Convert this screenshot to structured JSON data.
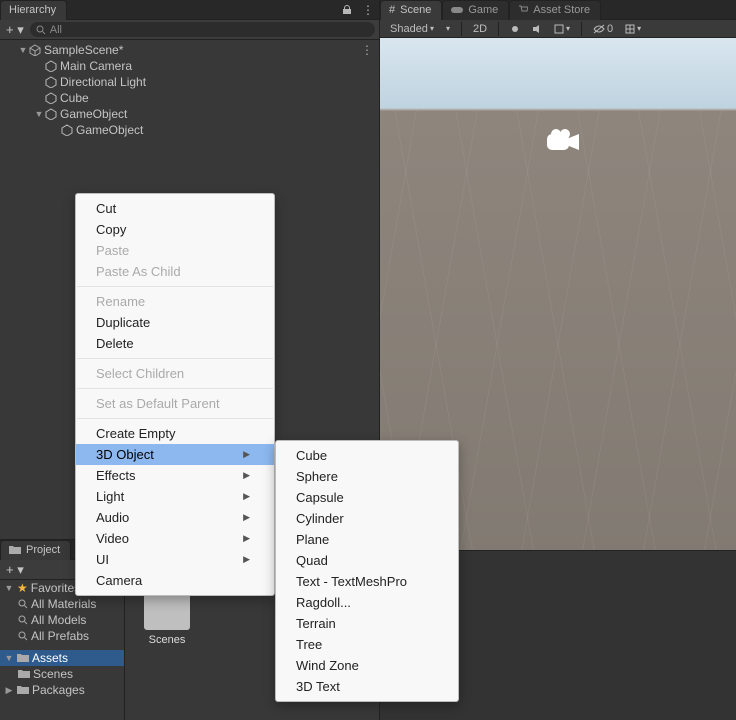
{
  "hierarchy": {
    "tab": "Hierarchy",
    "searchPlaceholder": "All",
    "scene": "SampleScene*",
    "items": [
      "Main Camera",
      "Directional Light",
      "Cube",
      "GameObject",
      "GameObject"
    ]
  },
  "project": {
    "tab": "Project",
    "favorites": {
      "label": "Favorites",
      "items": [
        "All Materials",
        "All Models",
        "All Prefabs"
      ]
    },
    "assets": {
      "label": "Assets",
      "items": [
        "Scenes"
      ]
    },
    "packages": "Packages",
    "content": {
      "folder": "Scenes"
    }
  },
  "scene": {
    "tabs": {
      "scene": "Scene",
      "game": "Game",
      "assetStore": "Asset Store"
    },
    "shading": "Shaded",
    "toolbar": {
      "twoD": "2D",
      "gizmoCount": "0"
    }
  },
  "contextMenu": {
    "cut": "Cut",
    "copy": "Copy",
    "paste": "Paste",
    "pasteAsChild": "Paste As Child",
    "rename": "Rename",
    "duplicate": "Duplicate",
    "delete": "Delete",
    "selectChildren": "Select Children",
    "setDefaultParent": "Set as Default Parent",
    "createEmpty": "Create Empty",
    "threeDObject": "3D Object",
    "effects": "Effects",
    "light": "Light",
    "audio": "Audio",
    "video": "Video",
    "ui": "UI",
    "camera": "Camera"
  },
  "subMenu3D": {
    "cube": "Cube",
    "sphere": "Sphere",
    "capsule": "Capsule",
    "cylinder": "Cylinder",
    "plane": "Plane",
    "quad": "Quad",
    "textTMP": "Text - TextMeshPro",
    "ragdoll": "Ragdoll...",
    "terrain": "Terrain",
    "tree": "Tree",
    "windZone": "Wind Zone",
    "threeDText": "3D Text"
  }
}
